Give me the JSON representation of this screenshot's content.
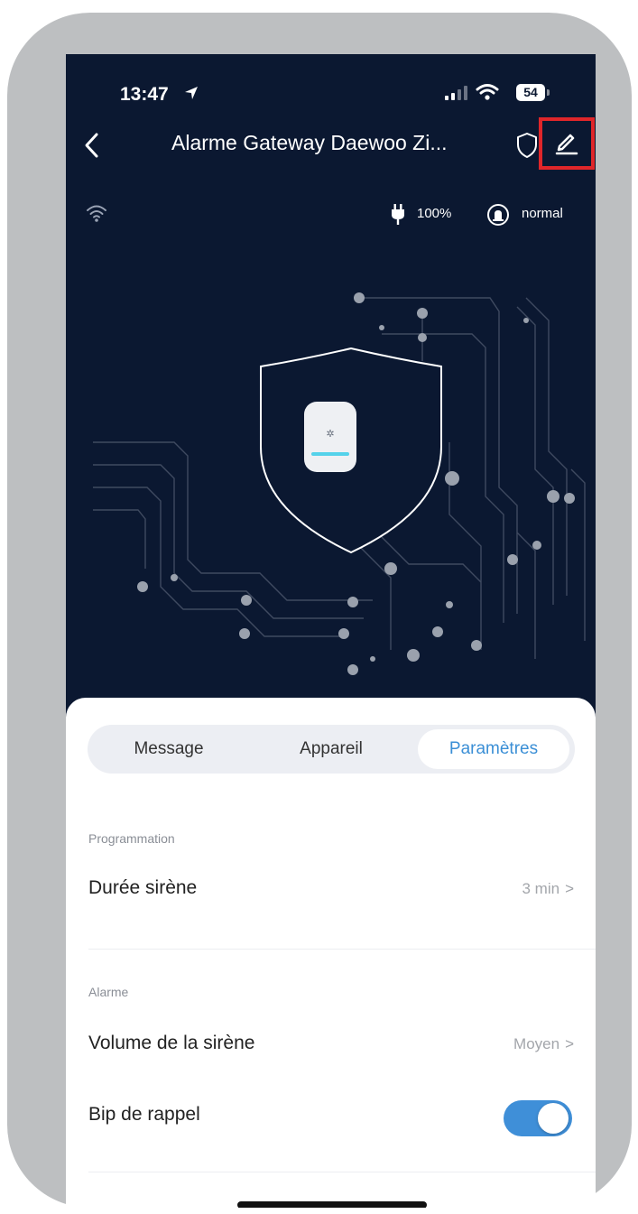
{
  "status_bar": {
    "time": "13:47",
    "battery": "54"
  },
  "header": {
    "title": "Alarme Gateway Daewoo Zi..."
  },
  "device_info": {
    "power": "100%",
    "alarm_status": "normal"
  },
  "tabs": [
    {
      "label": "Message"
    },
    {
      "label": "Appareil"
    },
    {
      "label": "Paramètres",
      "active": true
    }
  ],
  "settings": {
    "programmation": {
      "title": "Programmation",
      "duree_sirene": {
        "label": "Durée sirène",
        "value": "3 min"
      }
    },
    "alarme": {
      "title": "Alarme",
      "volume": {
        "label": "Volume de la sirène",
        "value": "Moyen"
      },
      "bip": {
        "label": "Bip de rappel",
        "on": true
      }
    }
  },
  "colors": {
    "background": "#0b1831",
    "accent": "#3b8fd6",
    "highlight_box": "#e0262a"
  }
}
